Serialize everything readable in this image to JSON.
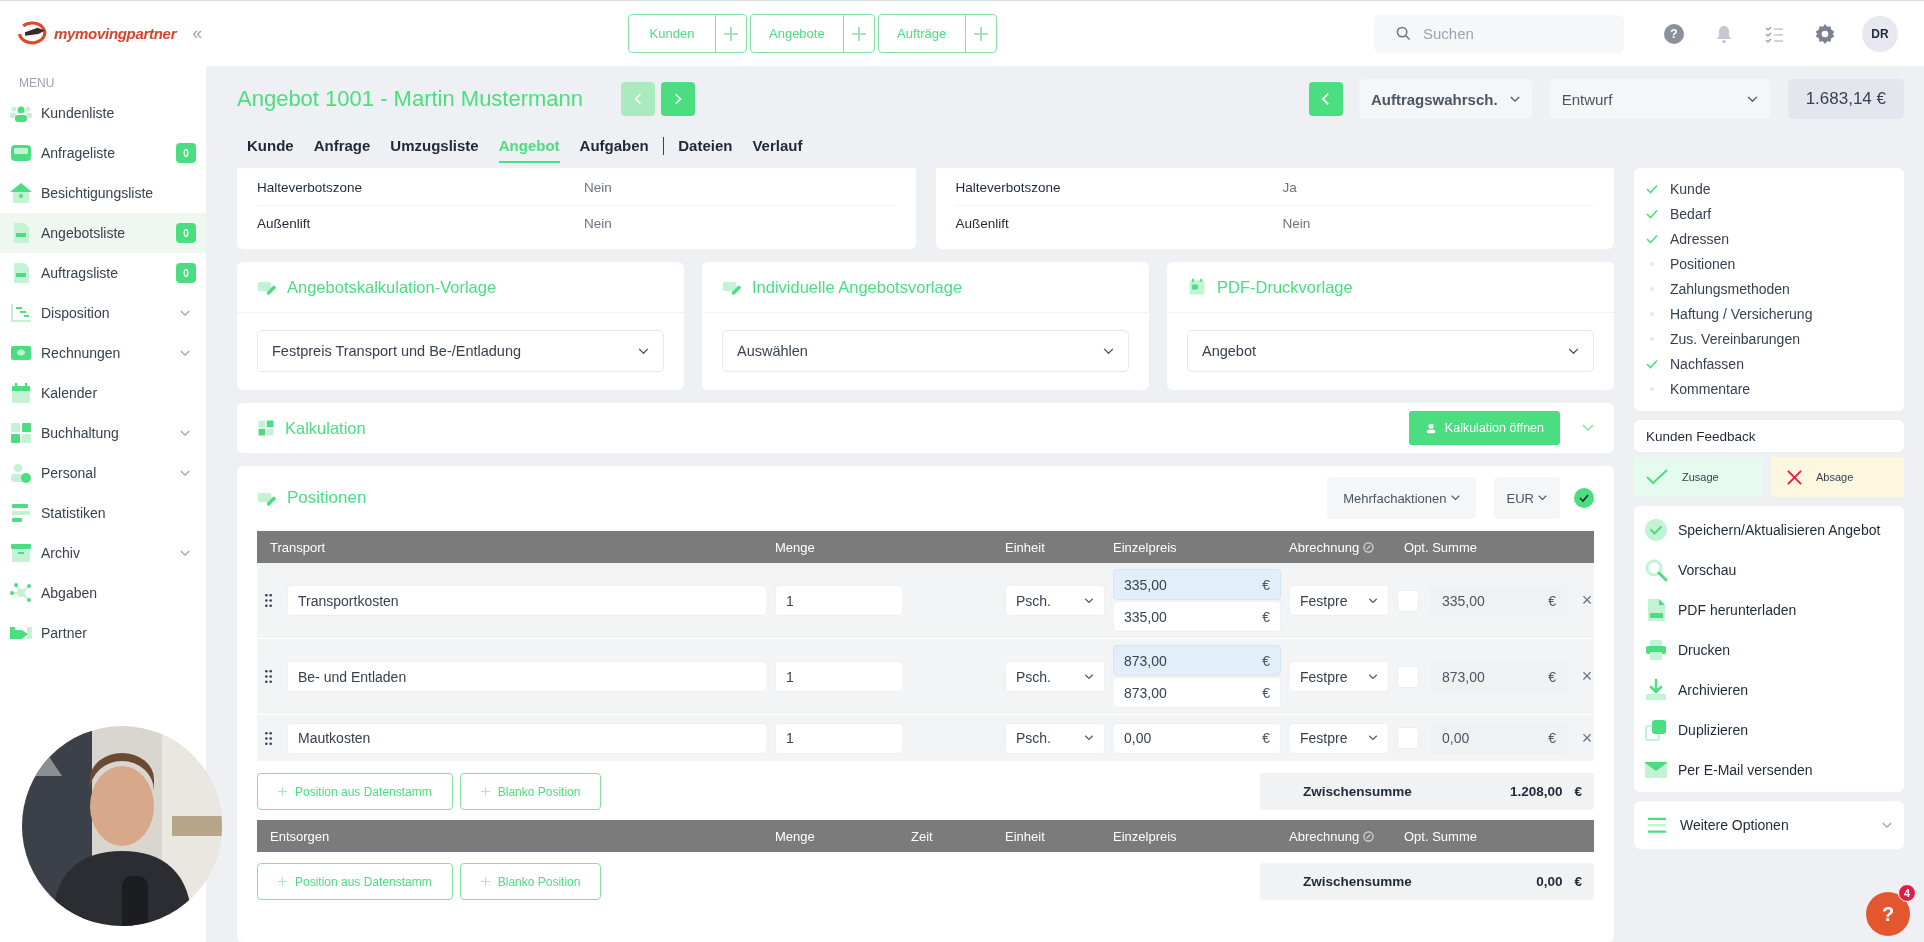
{
  "app": {
    "logo": "mymovingpartner",
    "collapse": "«"
  },
  "quick_actions": [
    {
      "label": "Kunden"
    },
    {
      "label": "Angebote"
    },
    {
      "label": "Aufträge"
    }
  ],
  "search": {
    "placeholder": "Suchen"
  },
  "help": "?",
  "user": {
    "initials": "DR"
  },
  "sidebar": {
    "heading": "MENU",
    "items": [
      {
        "label": "Kundenliste",
        "selected": false,
        "expandable": false
      },
      {
        "label": "Anfrageliste",
        "badge": "0",
        "selected": false,
        "expandable": false
      },
      {
        "label": "Besichtigungsliste",
        "selected": false,
        "expandable": false
      },
      {
        "label": "Angebotsliste",
        "badge": "0",
        "selected": true,
        "expandable": false
      },
      {
        "label": "Auftragsliste",
        "badge": "0",
        "selected": false,
        "expandable": false
      },
      {
        "label": "Disposition",
        "selected": false,
        "expandable": true
      },
      {
        "label": "Rechnungen",
        "selected": false,
        "expandable": true
      },
      {
        "label": "Kalender",
        "selected": false,
        "expandable": false
      },
      {
        "label": "Buchhaltung",
        "selected": false,
        "expandable": true
      },
      {
        "label": "Personal",
        "selected": false,
        "expandable": true
      },
      {
        "label": "Statistiken",
        "selected": false,
        "expandable": false
      },
      {
        "label": "Archiv",
        "selected": false,
        "expandable": true
      },
      {
        "label": "Abgaben",
        "selected": false,
        "expandable": false
      },
      {
        "label": "Partner",
        "selected": false,
        "expandable": false
      }
    ]
  },
  "video": {
    "kind": "picture"
  },
  "page": {
    "title": "Angebot 1001 - Martin Mustermann",
    "prev_enabled": false,
    "next_enabled": true
  },
  "status": {
    "probability": "Auftragswahrsch.",
    "state": "Entwurf",
    "total": "1.683,14 €"
  },
  "tabs": [
    {
      "label": "Kunde",
      "selected": false,
      "separated": false
    },
    {
      "label": "Anfrage",
      "selected": false,
      "separated": false
    },
    {
      "label": "Umzugsliste",
      "selected": false,
      "separated": false
    },
    {
      "label": "Angebot",
      "selected": true,
      "separated": false
    },
    {
      "label": "Aufgaben",
      "selected": false,
      "separated": false
    },
    {
      "label": "Dateien",
      "selected": false,
      "separated": true
    },
    {
      "label": "Verlauf",
      "selected": false,
      "separated": false
    }
  ],
  "details": [
    [
      {
        "label": "Halteverbotszone",
        "value": "Nein"
      },
      {
        "label": "Außenlift",
        "value": "Nein"
      }
    ],
    [
      {
        "label": "Halteverbotszone",
        "value": "Ja"
      },
      {
        "label": "Außenlift",
        "value": "Nein"
      }
    ]
  ],
  "templates": [
    {
      "title": "Angebotskalkulation-Vorlage",
      "value": "Festpreis Transport und Be-/Entladung"
    },
    {
      "title": "Individuelle Angebotsvorlage",
      "value": "Auswählen"
    },
    {
      "title": "PDF-Druckvorlage",
      "value": "Angebot"
    }
  ],
  "calculation": {
    "title": "Kalkulation",
    "button": "Kalkulation öffnen",
    "expanded": false
  },
  "positions": {
    "title": "Positionen",
    "bulk": "Mehrfachaktionen",
    "currency": "EUR",
    "confirmed": true,
    "sections": [
      {
        "columns": [
          {
            "kind": "name",
            "label": "Transport"
          },
          {
            "kind": "qty",
            "label": "Menge"
          },
          {
            "kind": "unit",
            "label": "Einheit"
          },
          {
            "kind": "price",
            "label": "Einzelpreis"
          },
          {
            "kind": "billing",
            "label": "Abrechnung"
          },
          {
            "kind": "sum",
            "label": "Opt. Summe"
          }
        ],
        "rows": [
          {
            "name": "Transportkosten",
            "qty": "1",
            "unit": "Psch.",
            "prices": [
              {
                "value": "335,00",
                "currency": "€",
                "highlighted": true
              },
              {
                "value": "335,00",
                "currency": "€",
                "highlighted": false
              }
            ],
            "billing": "Festpre",
            "optional": false,
            "sum": "335,00",
            "sum_currency": "€",
            "remove": "×"
          },
          {
            "name": "Be- und Entladen",
            "qty": "1",
            "unit": "Psch.",
            "prices": [
              {
                "value": "873,00",
                "currency": "€",
                "highlighted": true
              },
              {
                "value": "873,00",
                "currency": "€",
                "highlighted": false
              }
            ],
            "billing": "Festpre",
            "optional": false,
            "sum": "873,00",
            "sum_currency": "€",
            "remove": "×"
          },
          {
            "name": "Mautkosten",
            "qty": "1",
            "unit": "Psch.",
            "prices": [
              {
                "value": "0,00",
                "currency": "€",
                "highlighted": false
              }
            ],
            "billing": "Festpre",
            "optional": false,
            "sum": "0,00",
            "sum_currency": "€",
            "remove": "×"
          }
        ],
        "buttons": [
          "Position aus Datenstamm",
          "Blanko Position"
        ],
        "subtotal_label": "Zwischensumme",
        "subtotal": "1.208,00",
        "subtotal_currency": "€"
      },
      {
        "columns": [
          {
            "kind": "name",
            "label": "Entsorgen"
          },
          {
            "kind": "qty",
            "label": "Menge"
          },
          {
            "kind": "time",
            "label": "Zeit"
          },
          {
            "kind": "unit",
            "label": "Einheit"
          },
          {
            "kind": "price",
            "label": "Einzelpreis"
          },
          {
            "kind": "billing",
            "label": "Abrechnung"
          },
          {
            "kind": "sum",
            "label": "Opt. Summe"
          }
        ],
        "buttons": [
          "Position aus Datenstamm",
          "Blanko Position"
        ],
        "subtotal_label": "Zwischensumme",
        "subtotal": "0,00",
        "subtotal_currency": "€"
      }
    ]
  },
  "checklist": [
    {
      "label": "Kunde",
      "done": true
    },
    {
      "label": "Bedarf",
      "done": true
    },
    {
      "label": "Adressen",
      "done": true
    },
    {
      "label": "Positionen",
      "done": false
    },
    {
      "label": "Zahlungsmethoden",
      "done": false
    },
    {
      "label": "Haftung / Versicherung",
      "done": false
    },
    {
      "label": "Zus. Vereinbarungen",
      "done": false
    },
    {
      "label": "Nachfassen",
      "done": true
    },
    {
      "label": "Kommentare",
      "done": false
    }
  ],
  "feedback": {
    "title": "Kunden Feedback",
    "options": [
      {
        "label": "Zusage",
        "kind": "accept"
      },
      {
        "label": "Absage",
        "kind": "reject"
      }
    ]
  },
  "actions": [
    {
      "label": "Speichern/Aktualisieren Angebot"
    },
    {
      "label": "Vorschau"
    },
    {
      "label": "PDF herunterladen"
    },
    {
      "label": "Drucken"
    },
    {
      "label": "Archivieren"
    },
    {
      "label": "Duplizieren"
    },
    {
      "label": "Per E-Mail versenden"
    }
  ],
  "more": {
    "label": "Weitere Optionen",
    "expanded": false
  },
  "support": {
    "label": "?",
    "count": "4"
  }
}
